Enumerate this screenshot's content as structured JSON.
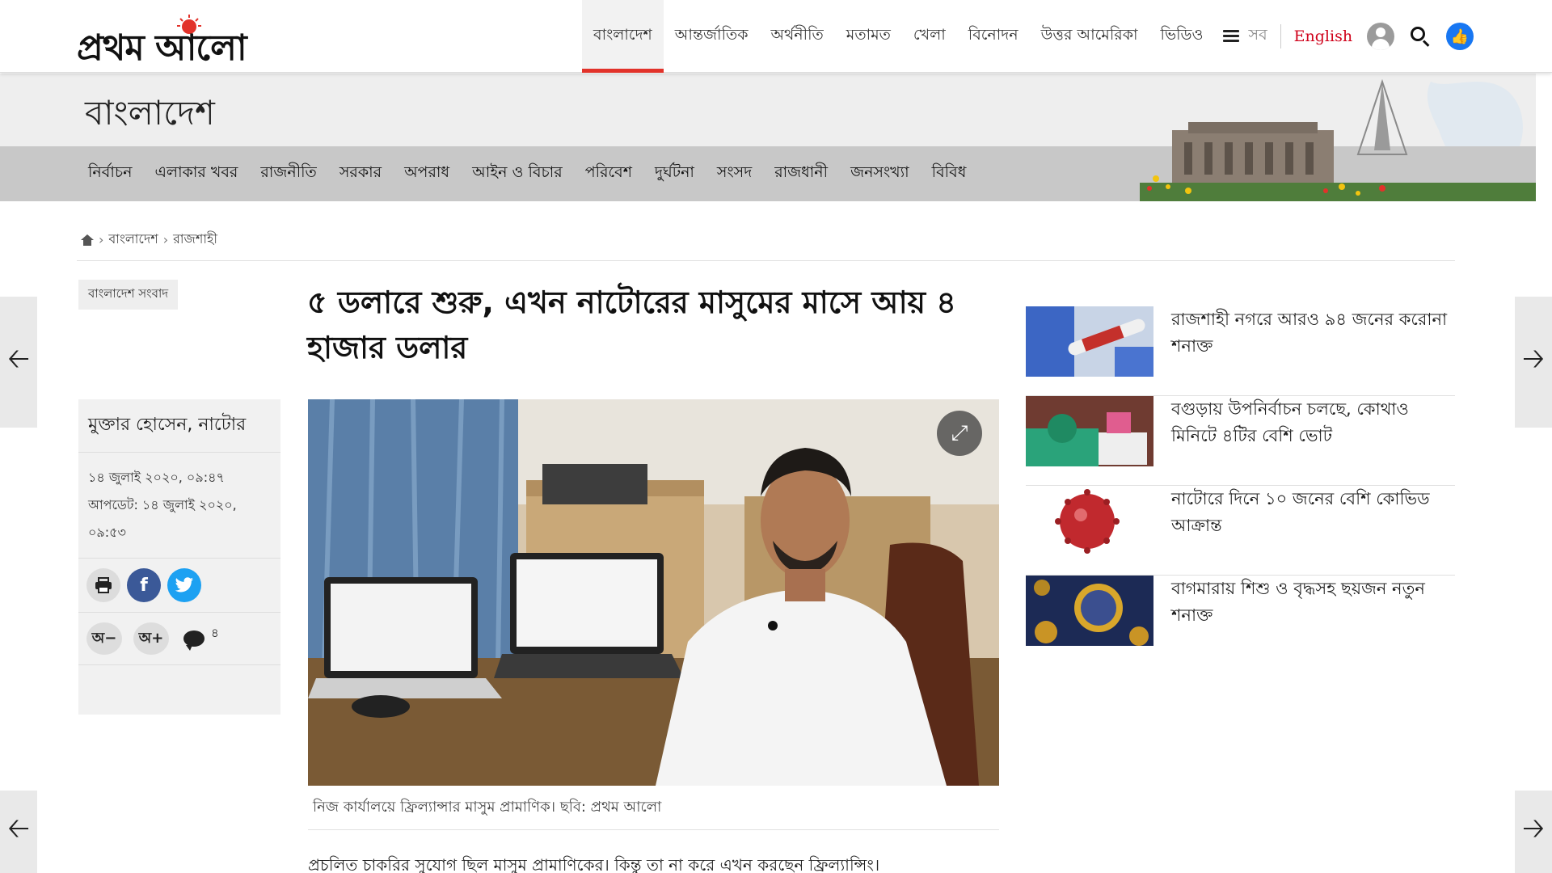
{
  "header": {
    "logo_text": "প্রথম আলো",
    "nav": [
      {
        "label": "বাংলাদেশ",
        "active": true
      },
      {
        "label": "আন্তর্জাতিক",
        "active": false
      },
      {
        "label": "অর্থনীতি",
        "active": false
      },
      {
        "label": "মতামত",
        "active": false
      },
      {
        "label": "খেলা",
        "active": false
      },
      {
        "label": "বিনোদন",
        "active": false
      },
      {
        "label": "উত্তর আমেরিকা",
        "active": false
      },
      {
        "label": "ভিডিও",
        "active": false
      }
    ],
    "menu_label": "সব",
    "english_label": "English",
    "icons": [
      "menu-icon",
      "user-avatar-icon",
      "search-icon",
      "like-icon"
    ],
    "accent_color": "#e2322a"
  },
  "section": {
    "title": "বাংলাদেশ",
    "subnav": [
      "নির্বাচন",
      "এলাকার খবর",
      "রাজনীতি",
      "সরকার",
      "অপরাধ",
      "আইন ও বিচার",
      "পরিবেশ",
      "দুর্ঘটনা",
      "সংসদ",
      "রাজধানী",
      "জনসংখ্যা",
      "বিবিধ"
    ]
  },
  "breadcrumb": {
    "items": [
      "বাংলাদেশ",
      "রাজশাহী"
    ],
    "separator": "›"
  },
  "article": {
    "tag": "বাংলাদেশ সংবাদ",
    "headline": "৫ ডলারে শুরু, এখন নাটোরের মাসুমের মাসে আয় ৪ হাজার ডলার",
    "author": "মুক্তার হোসেন, নাটোর",
    "published": "১৪ জুলাই ২০২০, ০৯:৪৭",
    "updated": "আপডেট: ১৪ জুলাই ২০২০, ০৯:৫৩",
    "comment_count": "৪",
    "font_decrease_label": "অ−",
    "font_increase_label": "অ+",
    "image_caption": "নিজ কার্যালয়ে ফ্রিল্যান্সার মাসুম প্রামাণিক। ছবি: প্রথম আলো",
    "body_first_line": "প্রচলিত চাকরির সুযোগ ছিল মাসুম প্রামাণিকের। কিন্তু তা না করে এখন করছেন ফ্রিল্যান্সিং।"
  },
  "related": [
    {
      "title": "রাজশাহী নগরে আরও ৯৪ জনের করোনা শনাক্ত"
    },
    {
      "title": "বগুড়ায় উপনির্বাচন চলছে, কোথাও মিনিটে ৪টির বেশি ভোট"
    },
    {
      "title": "নাটোরে দিনে ১০ জনের বেশি কোভিড আক্রান্ত"
    },
    {
      "title": "বাগমারায় শিশু ও বৃদ্ধসহ ছয়জন নতুন শনাক্ত"
    }
  ]
}
